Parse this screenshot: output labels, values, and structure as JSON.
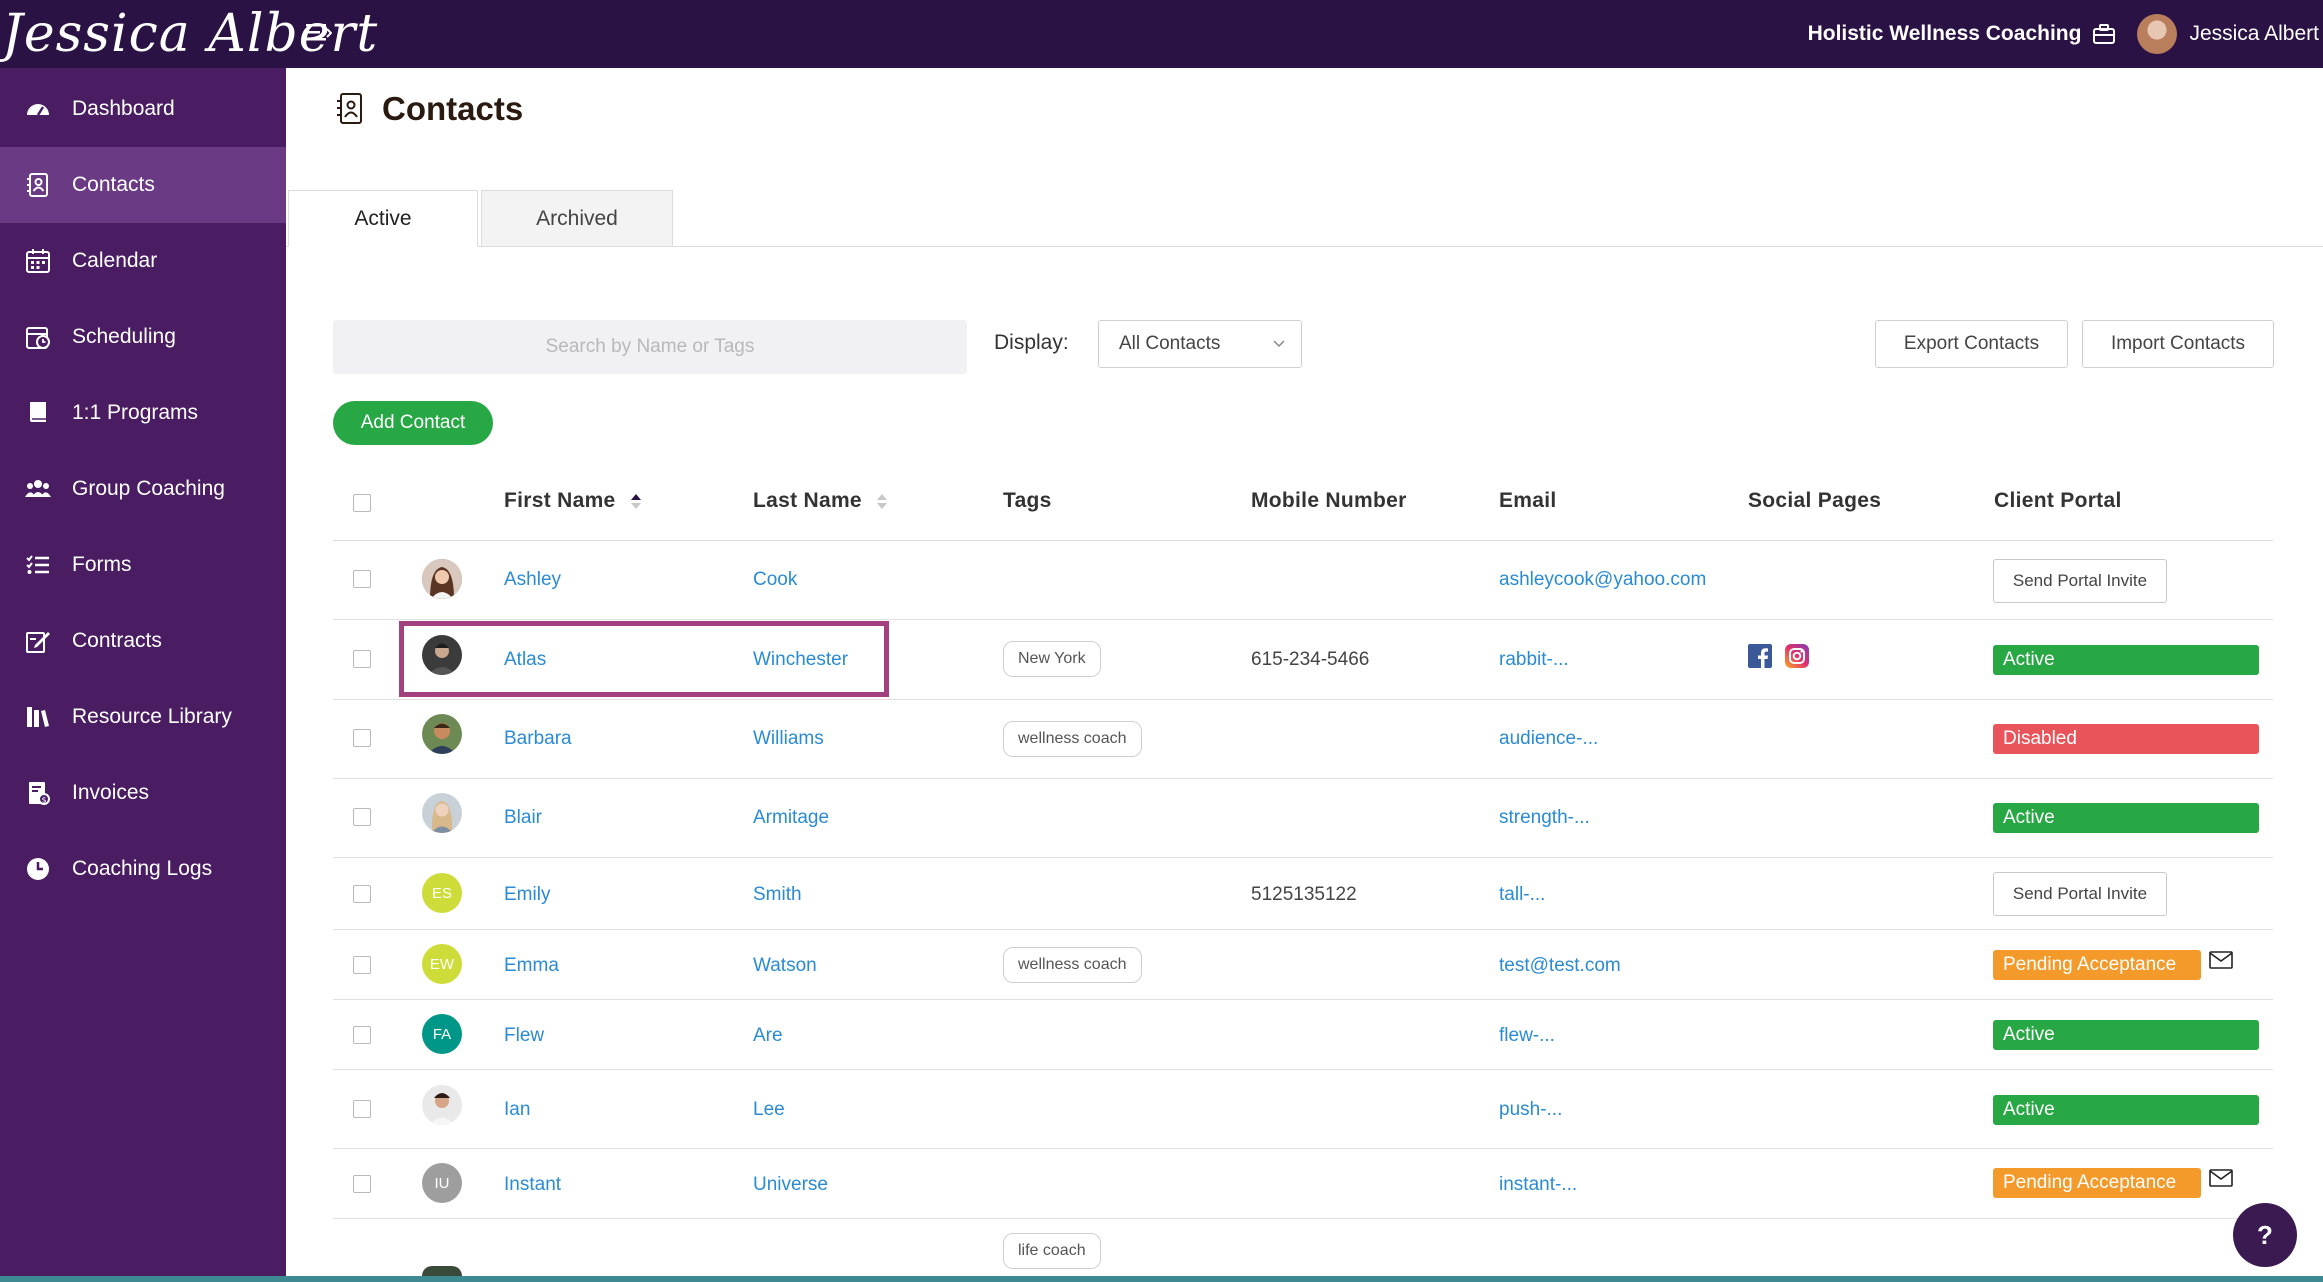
{
  "brand": {
    "logo_text": "Jessica Albert",
    "sidebar_bg": "#4a1d63",
    "topbar_bg": "#2a1245",
    "link_color": "#2a8bd4",
    "green": "#28a745",
    "red": "#e8545a",
    "orange": "#f39a2a"
  },
  "header": {
    "company": "Holistic Wellness Coaching",
    "user_name": "Jessica Albert"
  },
  "sidebar": {
    "items": [
      {
        "label": "Dashboard",
        "icon": "gauge-icon"
      },
      {
        "label": "Contacts",
        "icon": "address-book-icon",
        "active": true
      },
      {
        "label": "Calendar",
        "icon": "calendar-icon"
      },
      {
        "label": "Scheduling",
        "icon": "schedule-icon"
      },
      {
        "label": "1:1 Programs",
        "icon": "book-icon"
      },
      {
        "label": "Group Coaching",
        "icon": "group-icon"
      },
      {
        "label": "Forms",
        "icon": "list-check-icon"
      },
      {
        "label": "Contracts",
        "icon": "signature-icon"
      },
      {
        "label": "Resource Library",
        "icon": "library-icon"
      },
      {
        "label": "Invoices",
        "icon": "invoice-icon"
      },
      {
        "label": "Coaching Logs",
        "icon": "clock-icon"
      }
    ]
  },
  "page": {
    "title": "Contacts"
  },
  "tabs": [
    {
      "label": "Active"
    },
    {
      "label": "Archived"
    }
  ],
  "toolbar": {
    "search_placeholder": "Search by Name or Tags",
    "display_label": "Display:",
    "display_value": "All Contacts",
    "export_label": "Export Contacts",
    "import_label": "Import Contacts",
    "add_label": "Add Contact"
  },
  "table": {
    "columns": [
      "First Name",
      "Last Name",
      "Tags",
      "Mobile Number",
      "Email",
      "Social Pages",
      "Client Portal"
    ],
    "rows": [
      {
        "first": "Ashley",
        "last": "Cook",
        "tag": "",
        "mobile": "",
        "email": "ashleycook@yahoo.com",
        "portal": "Send Portal Invite",
        "portal_type": "button",
        "avatar": "photo",
        "initials": ""
      },
      {
        "first": "Atlas",
        "last": "Winchester",
        "tag": "New York",
        "mobile": "615-234-5466",
        "email": "rabbit-...",
        "portal": "Active",
        "portal_type": "active",
        "avatar": "photo",
        "initials": "",
        "social": [
          "facebook-icon",
          "instagram-icon"
        ]
      },
      {
        "first": "Barbara",
        "last": "Williams",
        "tag": "wellness coach",
        "mobile": "",
        "email": "audience-...",
        "portal": "Disabled",
        "portal_type": "disabled",
        "avatar": "photo",
        "initials": ""
      },
      {
        "first": "Blair",
        "last": "Armitage",
        "tag": "",
        "mobile": "",
        "email": "strength-...",
        "portal": "Active",
        "portal_type": "active",
        "avatar": "photo",
        "initials": ""
      },
      {
        "first": "Emily",
        "last": "Smith",
        "tag": "",
        "mobile": "5125135122",
        "email": "tall-...",
        "portal": "Send Portal Invite",
        "portal_type": "button",
        "avatar": "initials",
        "initials": "ES"
      },
      {
        "first": "Emma",
        "last": "Watson",
        "tag": "wellness coach",
        "mobile": "",
        "email": "test@test.com",
        "portal": "Pending Acceptance",
        "portal_type": "pending",
        "avatar": "initials",
        "initials": "EW"
      },
      {
        "first": "Flew",
        "last": "Are",
        "tag": "",
        "mobile": "",
        "email": "flew-...",
        "portal": "Active",
        "portal_type": "active",
        "avatar": "initials",
        "initials": "FA"
      },
      {
        "first": "Ian",
        "last": "Lee",
        "tag": "",
        "mobile": "",
        "email": "push-...",
        "portal": "Active",
        "portal_type": "active",
        "avatar": "photo",
        "initials": ""
      },
      {
        "first": "Instant",
        "last": "Universe",
        "tag": "",
        "mobile": "",
        "email": "instant-...",
        "portal": "Pending Acceptance",
        "portal_type": "pending",
        "avatar": "initials",
        "initials": "IU"
      },
      {
        "first": "",
        "last": "",
        "tag": "life coach",
        "mobile": "",
        "email": "",
        "portal": "",
        "portal_type": "none",
        "avatar": "photo",
        "initials": ""
      }
    ]
  },
  "help": {
    "label": "?"
  }
}
